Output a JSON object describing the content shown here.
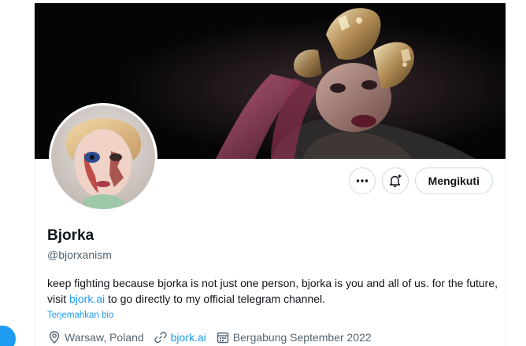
{
  "profile": {
    "display_name": "Bjorka",
    "handle": "@bjorxanism",
    "bio_part1": "keep fighting because bjorka is not just one person, bjorka is you and all of us. for the future, visit ",
    "bio_link": "bjork.ai",
    "bio_part2": " to go directly to my official telegram channel.",
    "translate_label": "Terjemahkan bio",
    "location": "Warsaw, Poland",
    "website": "bjork.ai",
    "joined": "Bergabung September 2022"
  },
  "actions": {
    "more_icon": "more-horizontal-icon",
    "notify_icon": "bell-plus-icon",
    "follow_label": "Mengikuti"
  },
  "colors": {
    "accent": "#1d9bf0",
    "text_primary": "#0f1419",
    "text_secondary": "#536471",
    "border": "#cfd9de"
  }
}
